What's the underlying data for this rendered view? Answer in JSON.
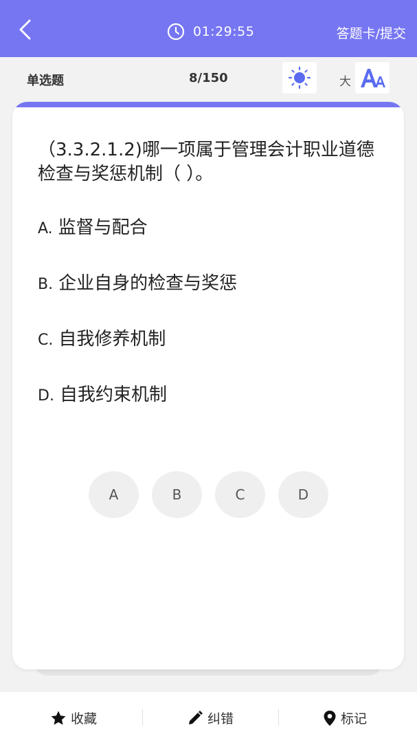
{
  "header": {
    "back_icon": "chevron-left-icon",
    "timer_icon": "clock-icon",
    "timer": "01:29:55",
    "answer_card_label": "答题卡/提交",
    "bg_color": "#7676f2"
  },
  "subbar": {
    "question_type": "单选题",
    "progress": "8/150",
    "theme_icon": "sun-icon",
    "font_size_label": "大",
    "font_icon": "font-size-icon"
  },
  "question": {
    "text": "（3.3.2.1.2)哪一项属于管理会计职业道德检查与奖惩机制（    ）。",
    "options": [
      {
        "letter": "A.",
        "text": "监督与配合"
      },
      {
        "letter": "B.",
        "text": "企业自身的检查与奖惩"
      },
      {
        "letter": "C.",
        "text": "自我修养机制"
      },
      {
        "letter": "D.",
        "text": "自我约束机制"
      }
    ],
    "answer_buttons": [
      "A",
      "B",
      "C",
      "D"
    ]
  },
  "bottom": {
    "favorite_label": "收藏",
    "favorite_icon": "star-icon",
    "report_label": "纠错",
    "report_icon": "pencil-icon",
    "mark_label": "标记",
    "mark_icon": "location-pin-icon"
  }
}
